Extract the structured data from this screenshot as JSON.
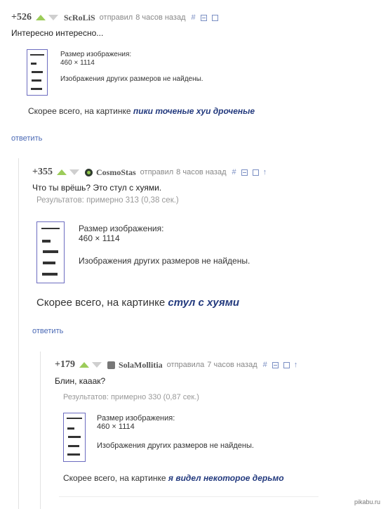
{
  "comments": [
    {
      "rating": "+526",
      "username": "ScRoLiS",
      "verb": "отправил",
      "time": "8 часов назад",
      "text": "Интересно интересно...",
      "image_size_label": "Размер изображения:",
      "image_size": "460 × 1114",
      "no_other_sizes": "Изображения других размеров не найдены.",
      "guess_prefix": "Скорее всего, на картинке",
      "guess": "пики точеные хуи дроченые",
      "reply": "ответить"
    },
    {
      "rating": "+355",
      "username": "CosmoStas",
      "verb": "отправил",
      "time": "8 часов назад",
      "text": "Что ты врёшь? Это стул с хуями.",
      "results": "Результатов: примерно 313 (0,38 сек.)",
      "image_size_label": "Размер изображения:",
      "image_size": "460 × 1114",
      "no_other_sizes": "Изображения других размеров не найдены.",
      "guess_prefix": "Скорее всего, на картинке",
      "guess": "стул с хуями",
      "reply": "ответить"
    },
    {
      "rating": "+179",
      "username": "SolaMollitia",
      "verb": "отправила",
      "time": "7 часов назад",
      "text": "Блин, кааак?",
      "results": "Результатов: примерно 330 (0,87 сек.)",
      "image_size_label": "Размер изображения:",
      "image_size": "460 × 1114",
      "no_other_sizes": "Изображения других размеров не найдены.",
      "guess_prefix": "Скорее всего, на картинке",
      "guess": "я видел некоторое дерьмо"
    }
  ],
  "icons": {
    "hash": "#",
    "up": "↑"
  },
  "watermark": "pikabu.ru",
  "colors": {
    "upvote": "#9ccc5a",
    "link": "#4a69b5",
    "accent_text": "#233a7e"
  }
}
